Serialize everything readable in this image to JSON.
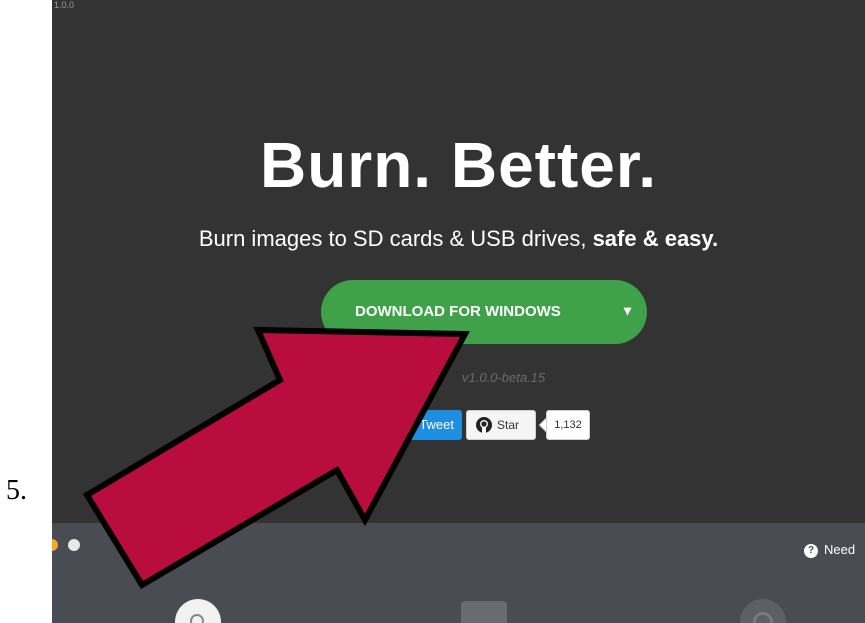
{
  "step_number": "5.",
  "app": {
    "version_top": "1.0.0",
    "headline": "Burn. Better.",
    "tagline_plain": "Burn images to SD cards & USB drives,",
    "tagline_bold": "safe & easy.",
    "download_button": "DOWNLOAD FOR WINDOWS",
    "download_caret": "▾",
    "version_line": "v1.0.0-beta.15",
    "tweet_label": "Tweet",
    "star_label": "Star",
    "star_count": "1,132"
  },
  "bottom_bar": {
    "help_text": "Need"
  },
  "colors": {
    "background": "#333333",
    "download_green": "#3fa24a",
    "arrow_crimson": "#b90d3e",
    "tweet_blue": "#1f8ee0",
    "bottom_bar": "#494c52"
  },
  "icons": [
    "github-icon",
    "help-icon",
    "caret-down-icon",
    "select-image-icon",
    "select-drive-icon",
    "flash-icon"
  ]
}
